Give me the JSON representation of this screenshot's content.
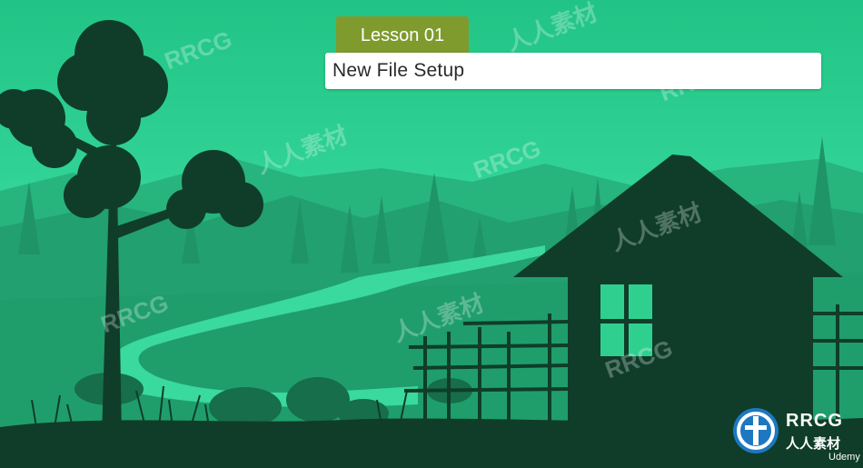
{
  "lesson": {
    "tag": "Lesson 01",
    "title": "New File Setup"
  },
  "watermarks": [
    "RRCG",
    "人人素材",
    "RRCG",
    "人人素材",
    "RRCG",
    "人人素材",
    "RRCG",
    "人人素材",
    "RRCG"
  ],
  "logo": {
    "name": "RRCG",
    "subtitle": "人人素材"
  },
  "brand": "Udemy",
  "colors": {
    "sky": "#2fd08f",
    "tag_bg": "#7f9b2e",
    "silhouette": "#0f3d2a"
  }
}
